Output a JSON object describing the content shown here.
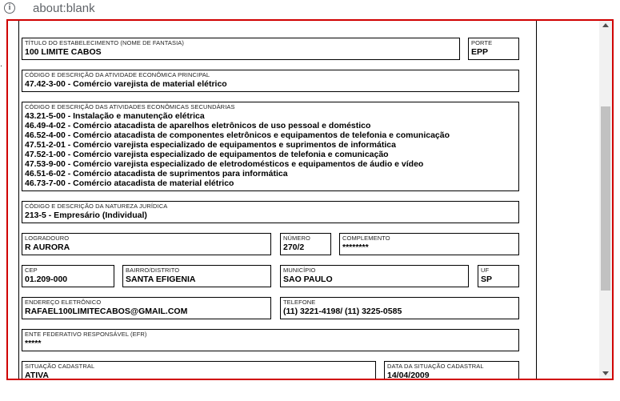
{
  "browser": {
    "url": "about:blank",
    "info_icon": "info-icon"
  },
  "form": {
    "fantasia": {
      "label": "TÍTULO DO ESTABELECIMENTO (NOME DE FANTASIA)",
      "value": "100 LIMITE CABOS"
    },
    "porte": {
      "label": "PORTE",
      "value": "EPP"
    },
    "atividade_principal": {
      "label": "CÓDIGO E DESCRIÇÃO DA ATIVIDADE ECONÔMICA PRINCIPAL",
      "value": "47.42-3-00 - Comércio varejista de material elétrico"
    },
    "atividades_secundarias": {
      "label": "CÓDIGO E DESCRIÇÃO DAS ATIVIDADES ECONÔMICAS SECUNDÁRIAS",
      "items": [
        "43.21-5-00 - Instalação e manutenção elétrica",
        "46.49-4-02 - Comércio atacadista de aparelhos eletrônicos de uso pessoal e doméstico",
        "46.52-4-00 - Comércio atacadista de componentes eletrônicos e equipamentos de telefonia e comunicação",
        "47.51-2-01 - Comércio varejista especializado de equipamentos e suprimentos de informática",
        "47.52-1-00 - Comércio varejista especializado de equipamentos de telefonia e comunicação",
        "47.53-9-00 - Comércio varejista especializado de eletrodomésticos e equipamentos de áudio e vídeo",
        "46.51-6-02 - Comércio atacadista de suprimentos para informática",
        "46.73-7-00 - Comércio atacadista de material elétrico"
      ]
    },
    "natureza_juridica": {
      "label": "CÓDIGO E DESCRIÇÃO DA NATUREZA JURÍDICA",
      "value": "213-5 - Empresário (Individual)"
    },
    "logradouro": {
      "label": "LOGRADOURO",
      "value": "R AURORA"
    },
    "numero": {
      "label": "NÚMERO",
      "value": "270/2"
    },
    "complemento": {
      "label": "COMPLEMENTO",
      "value": "********"
    },
    "cep": {
      "label": "CEP",
      "value": "01.209-000"
    },
    "bairro": {
      "label": "BAIRRO/DISTRITO",
      "value": "SANTA EFIGENIA"
    },
    "municipio": {
      "label": "MUNICÍPIO",
      "value": "SAO PAULO"
    },
    "uf": {
      "label": "UF",
      "value": "SP"
    },
    "email": {
      "label": "ENDEREÇO ELETRÔNICO",
      "value": "RAFAEL100LIMITECABOS@GMAIL.COM"
    },
    "telefone": {
      "label": "TELEFONE",
      "value": "(11) 3221-4198/ (11) 3225-0585"
    },
    "efr": {
      "label": "ENTE FEDERATIVO RESPONSÁVEL (EFR)",
      "value": "*****"
    },
    "situacao": {
      "label": "SITUAÇÃO CADASTRAL",
      "value": "ATIVA"
    },
    "data_situacao": {
      "label": "DATA DA SITUAÇÃO CADASTRAL",
      "value": "14/04/2009"
    }
  }
}
